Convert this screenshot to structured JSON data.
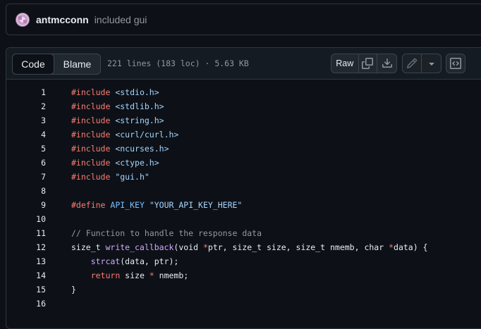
{
  "commit": {
    "author": "antmcconn",
    "message": "included gui"
  },
  "file_header": {
    "tabs": [
      "Code",
      "Blame"
    ],
    "active_tab": "Code",
    "info": "221 lines (183 loc) · 5.63 KB",
    "raw_label": "Raw"
  },
  "icons": [
    "copy-icon",
    "download-icon",
    "pencil-icon",
    "chevron-down-icon",
    "symbols-icon"
  ],
  "code_lines": [
    {
      "n": "1",
      "tokens": [
        {
          "t": "#include",
          "c": "kw"
        },
        {
          "t": " "
        },
        {
          "t": "<stdio.h>",
          "c": "str"
        }
      ]
    },
    {
      "n": "2",
      "tokens": [
        {
          "t": "#include",
          "c": "kw"
        },
        {
          "t": " "
        },
        {
          "t": "<stdlib.h>",
          "c": "str"
        }
      ]
    },
    {
      "n": "3",
      "tokens": [
        {
          "t": "#include",
          "c": "kw"
        },
        {
          "t": " "
        },
        {
          "t": "<string.h>",
          "c": "str"
        }
      ]
    },
    {
      "n": "4",
      "tokens": [
        {
          "t": "#include",
          "c": "kw"
        },
        {
          "t": " "
        },
        {
          "t": "<curl/curl.h>",
          "c": "str"
        }
      ]
    },
    {
      "n": "5",
      "tokens": [
        {
          "t": "#include",
          "c": "kw"
        },
        {
          "t": " "
        },
        {
          "t": "<ncurses.h>",
          "c": "str"
        }
      ]
    },
    {
      "n": "6",
      "tokens": [
        {
          "t": "#include",
          "c": "kw"
        },
        {
          "t": " "
        },
        {
          "t": "<ctype.h>",
          "c": "str"
        }
      ]
    },
    {
      "n": "7",
      "tokens": [
        {
          "t": "#include",
          "c": "kw"
        },
        {
          "t": " "
        },
        {
          "t": "\"gui.h\"",
          "c": "str"
        }
      ]
    },
    {
      "n": "8",
      "tokens": []
    },
    {
      "n": "9",
      "tokens": [
        {
          "t": "#define",
          "c": "kw"
        },
        {
          "t": " "
        },
        {
          "t": "API_KEY",
          "c": "mac"
        },
        {
          "t": " "
        },
        {
          "t": "\"YOUR_API_KEY_HERE\"",
          "c": "str"
        }
      ]
    },
    {
      "n": "10",
      "tokens": []
    },
    {
      "n": "11",
      "tokens": [
        {
          "t": "// Function to handle the response data",
          "c": "cm"
        }
      ]
    },
    {
      "n": "12",
      "tokens": [
        {
          "t": "size_t "
        },
        {
          "t": "write_callback",
          "c": "fn"
        },
        {
          "t": "(void "
        },
        {
          "t": "*",
          "c": "kw"
        },
        {
          "t": "ptr, size_t size, size_t nmemb, char "
        },
        {
          "t": "*",
          "c": "kw"
        },
        {
          "t": "data) {"
        }
      ]
    },
    {
      "n": "13",
      "tokens": [
        {
          "t": "    "
        },
        {
          "t": "strcat",
          "c": "fn"
        },
        {
          "t": "(data, ptr);"
        }
      ]
    },
    {
      "n": "14",
      "tokens": [
        {
          "t": "    "
        },
        {
          "t": "return",
          "c": "kw"
        },
        {
          "t": " size "
        },
        {
          "t": "*",
          "c": "kw"
        },
        {
          "t": " nmemb;"
        }
      ]
    },
    {
      "n": "15",
      "tokens": [
        {
          "t": "}"
        }
      ]
    },
    {
      "n": "16",
      "tokens": []
    }
  ]
}
